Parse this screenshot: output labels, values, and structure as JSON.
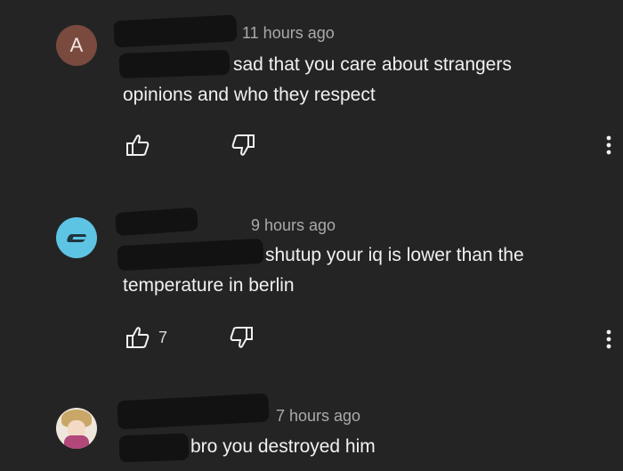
{
  "comments": [
    {
      "avatar_letter": "A",
      "avatar_color": "#7a4a3f",
      "timestamp": "11 hours ago",
      "mention": "",
      "text": "sad that you care about strangers opinions and who they respect",
      "like_count": ""
    },
    {
      "avatar_color": "#5ec4e3",
      "timestamp": "9 hours ago",
      "mention": "",
      "text": "shutup your iq is lower than the temperature in berlin",
      "like_count": "7"
    },
    {
      "avatar_color": "#efe7dc",
      "timestamp": "7 hours ago",
      "mention": "",
      "text": "bro you destroyed him",
      "like_count": ""
    }
  ],
  "icons": {
    "like": "thumbs-up-icon",
    "dislike": "thumbs-down-icon",
    "more": "more-vertical-icon"
  }
}
